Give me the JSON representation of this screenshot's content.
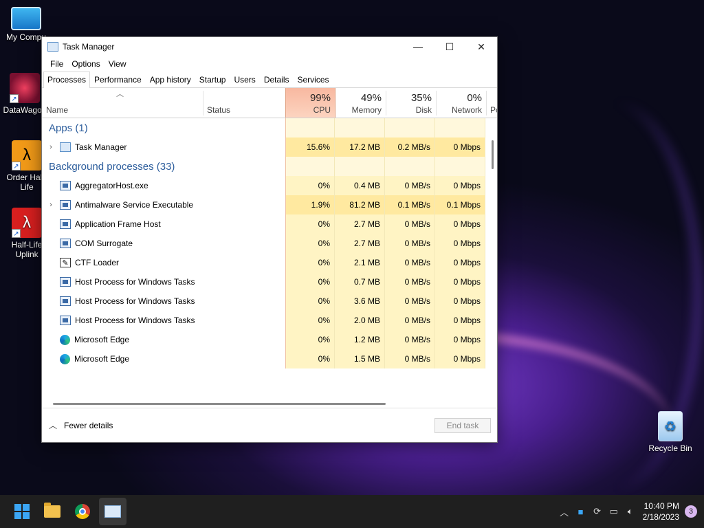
{
  "desktop": {
    "icons": [
      {
        "label": "My Compu"
      },
      {
        "label": "DataWagon"
      },
      {
        "label": "Order Half-Life"
      },
      {
        "label": "Half-Life Uplink"
      },
      {
        "label": "Recycle Bin"
      }
    ]
  },
  "window": {
    "title": "Task Manager",
    "controls": {
      "minimize": "—",
      "maximize": "☐",
      "close": "✕"
    },
    "menu": [
      "File",
      "Options",
      "View"
    ],
    "tabs": [
      "Processes",
      "Performance",
      "App history",
      "Startup",
      "Users",
      "Details",
      "Services"
    ],
    "header": {
      "name": "Name",
      "status": "Status",
      "cpu": {
        "pct": "99%",
        "label": "CPU"
      },
      "memory": {
        "pct": "49%",
        "label": "Memory"
      },
      "disk": {
        "pct": "35%",
        "label": "Disk"
      },
      "network": {
        "pct": "0%",
        "label": "Network"
      },
      "power": "Po"
    },
    "groups": {
      "apps": "Apps (1)",
      "background": "Background processes (33)"
    },
    "apps": [
      {
        "name": "Task Manager",
        "cpu": "15.6%",
        "memory": "17.2 MB",
        "disk": "0.2 MB/s",
        "network": "0 Mbps",
        "icon": "task-manager-icon",
        "expand": true
      }
    ],
    "background": [
      {
        "name": "AggregatorHost.exe",
        "cpu": "0%",
        "memory": "0.4 MB",
        "disk": "0 MB/s",
        "network": "0 Mbps",
        "icon": "window-icon",
        "expand": false
      },
      {
        "name": "Antimalware Service Executable",
        "cpu": "1.9%",
        "memory": "81.2 MB",
        "disk": "0.1 MB/s",
        "network": "0.1 Mbps",
        "icon": "window-icon",
        "expand": true
      },
      {
        "name": "Application Frame Host",
        "cpu": "0%",
        "memory": "2.7 MB",
        "disk": "0 MB/s",
        "network": "0 Mbps",
        "icon": "window-icon",
        "expand": false
      },
      {
        "name": "COM Surrogate",
        "cpu": "0%",
        "memory": "2.7 MB",
        "disk": "0 MB/s",
        "network": "0 Mbps",
        "icon": "window-icon",
        "expand": false
      },
      {
        "name": "CTF Loader",
        "cpu": "0%",
        "memory": "2.1 MB",
        "disk": "0 MB/s",
        "network": "0 Mbps",
        "icon": "ctf-icon",
        "expand": false
      },
      {
        "name": "Host Process for Windows Tasks",
        "cpu": "0%",
        "memory": "0.7 MB",
        "disk": "0 MB/s",
        "network": "0 Mbps",
        "icon": "window-icon",
        "expand": false
      },
      {
        "name": "Host Process for Windows Tasks",
        "cpu": "0%",
        "memory": "3.6 MB",
        "disk": "0 MB/s",
        "network": "0 Mbps",
        "icon": "window-icon",
        "expand": false
      },
      {
        "name": "Host Process for Windows Tasks",
        "cpu": "0%",
        "memory": "2.0 MB",
        "disk": "0 MB/s",
        "network": "0 Mbps",
        "icon": "window-icon",
        "expand": false
      },
      {
        "name": "Microsoft Edge",
        "cpu": "0%",
        "memory": "1.2 MB",
        "disk": "0 MB/s",
        "network": "0 Mbps",
        "icon": "edge-icon",
        "expand": false
      },
      {
        "name": "Microsoft Edge",
        "cpu": "0%",
        "memory": "1.5 MB",
        "disk": "0 MB/s",
        "network": "0 Mbps",
        "icon": "edge-icon",
        "expand": false
      }
    ],
    "footer": {
      "fewer_details": "Fewer details",
      "end_task": "End task"
    }
  },
  "taskbar": {
    "clock_time": "10:40 PM",
    "clock_date": "2/18/2023",
    "notification_count": "3"
  }
}
